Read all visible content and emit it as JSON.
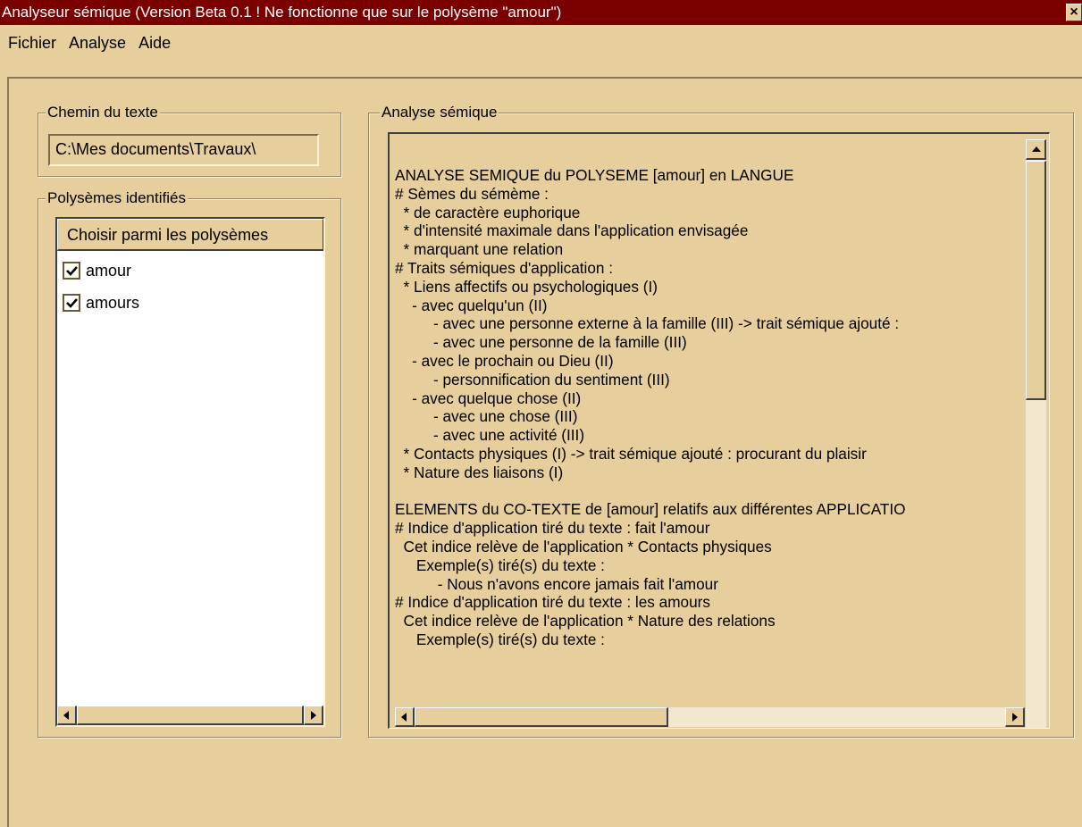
{
  "window": {
    "title": "Analyseur sémique (Version Beta 0.1 ! Ne fonctionne que sur le polysème \"amour\")",
    "close_label": "×"
  },
  "menu": [
    "Fichier",
    "Analyse",
    "Aide"
  ],
  "path_group": {
    "label": "Chemin du texte",
    "value": "C:\\Mes documents\\Travaux\\"
  },
  "polysemes_group": {
    "label": "Polysèmes identifiés",
    "header": "Choisir parmi les polysèmes",
    "items": [
      {
        "label": "amour",
        "checked": true
      },
      {
        "label": "amours",
        "checked": true
      }
    ]
  },
  "analysis_group": {
    "label": "Analyse sémique",
    "lines": [
      "ANALYSE SEMIQUE du POLYSEME [amour] en LANGUE",
      "# Sèmes du sémème :",
      "  * de caractère euphorique",
      "  * d'intensité maximale dans l'application envisagée",
      "  * marquant une relation",
      "# Traits sémiques d'application :",
      "  * Liens affectifs ou psychologiques (I)",
      "    - avec quelqu'un (II)",
      "         - avec une personne externe à la famille (III) -> trait sémique ajouté :",
      "         - avec une personne de la famille (III)",
      "    - avec le prochain ou Dieu (II)",
      "         - personnification du sentiment (III)",
      "    - avec quelque chose (II)",
      "         - avec une chose (III)",
      "         - avec une activité (III)",
      "  * Contacts physiques (I) -> trait sémique ajouté : procurant du plaisir",
      "  * Nature des liaisons (I)",
      "",
      "ELEMENTS du CO-TEXTE de [amour] relatifs aux différentes APPLICATIO",
      "# Indice d'application tiré du texte : fait l'amour",
      "  Cet indice relève de l'application * Contacts physiques",
      "     Exemple(s) tiré(s) du texte :",
      "          - Nous n'avons encore jamais fait l'amour",
      "# Indice d'application tiré du texte : les amours",
      "  Cet indice relève de l'application * Nature des relations",
      "     Exemple(s) tiré(s) du texte :"
    ]
  },
  "colors": {
    "titlebar": "#7B0000",
    "face": "#E6CE9D",
    "scroll_track": "#F3E7CE"
  }
}
